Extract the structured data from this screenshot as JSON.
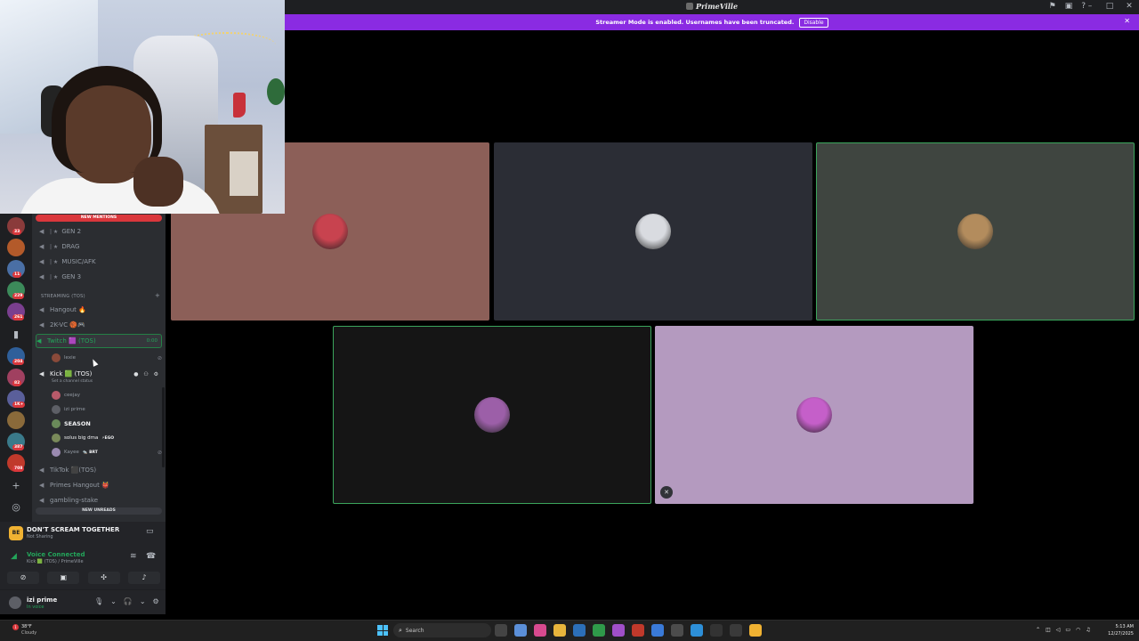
{
  "window": {
    "title": "PrimeVille",
    "banner_message": "Streamer Mode is enabled. Usernames have been truncated.",
    "banner_button": "Disable"
  },
  "server_rail": {
    "badges": [
      "33",
      "11",
      "229",
      "261",
      "204",
      "82",
      "1K+",
      "387",
      "708"
    ]
  },
  "sidebar": {
    "new_mentions": "NEW MENTIONS",
    "new_unreads": "NEW UNREADS",
    "channels_top": [
      {
        "name": "GEN 2"
      },
      {
        "name": "DRAG"
      },
      {
        "name": "MUSIC/AFK"
      },
      {
        "name": "GEN 3"
      }
    ],
    "category": "STREAMING (TOS)",
    "hangout": "Hangout 🔥",
    "twokvc": "2K-VC 🏀🎮",
    "twitch": {
      "name": "Twitch 🟪 (TOS)",
      "timer": "0:00",
      "user": "lexie"
    },
    "kick": {
      "name": "Kick 🟩 (TOS)",
      "status": "Set a channel status"
    },
    "kick_users": [
      {
        "name": "ceejay",
        "tag": "",
        "bold": false
      },
      {
        "name": "izi prime",
        "tag": "",
        "bold": false
      },
      {
        "name": "SEASON",
        "tag": "",
        "bold": true
      },
      {
        "name": "solus big dma",
        "tag": "⚡EGO",
        "bold": false
      },
      {
        "name": "Kayee",
        "tag": "🐀 BRT",
        "bold": false
      }
    ],
    "channels_bottom": [
      {
        "name": "TikTok ⬛(TOS)"
      },
      {
        "name": "Primes Hangout 👹"
      },
      {
        "name": "gambling-stake"
      }
    ]
  },
  "activity": {
    "icon": "BE",
    "title": "DON'T SCREAM TOGETHER",
    "subtitle": "Not Sharing"
  },
  "voice": {
    "status": "Voice Connected",
    "channel": "Kick 🟩 (TOS) / PrimeVille"
  },
  "user": {
    "name": "izi prime",
    "status": "In voice"
  },
  "tiles": [
    {
      "name": "tile-1",
      "bg": "#8c5f58",
      "avatar": "#c8434f"
    },
    {
      "name": "tile-2",
      "bg": "#2b2d35",
      "avatar": "#d9dbe0"
    },
    {
      "name": "tile-3",
      "bg": "#3f4540",
      "avatar": "#b38c5d"
    },
    {
      "name": "tile-4",
      "bg": "#151515",
      "avatar": "#9c5fa8"
    },
    {
      "name": "tile-5",
      "bg": "#b49abf",
      "avatar": "#c55fc9"
    }
  ],
  "taskbar": {
    "weather_temp": "38°F",
    "weather_desc": "Cloudy",
    "search_placeholder": "Search",
    "time": "5:13 AM",
    "date": "12/27/2025"
  },
  "colors": {
    "banner": "#8a2be2",
    "speaking": "#3ba55c",
    "discord_green": "#23a55a"
  }
}
